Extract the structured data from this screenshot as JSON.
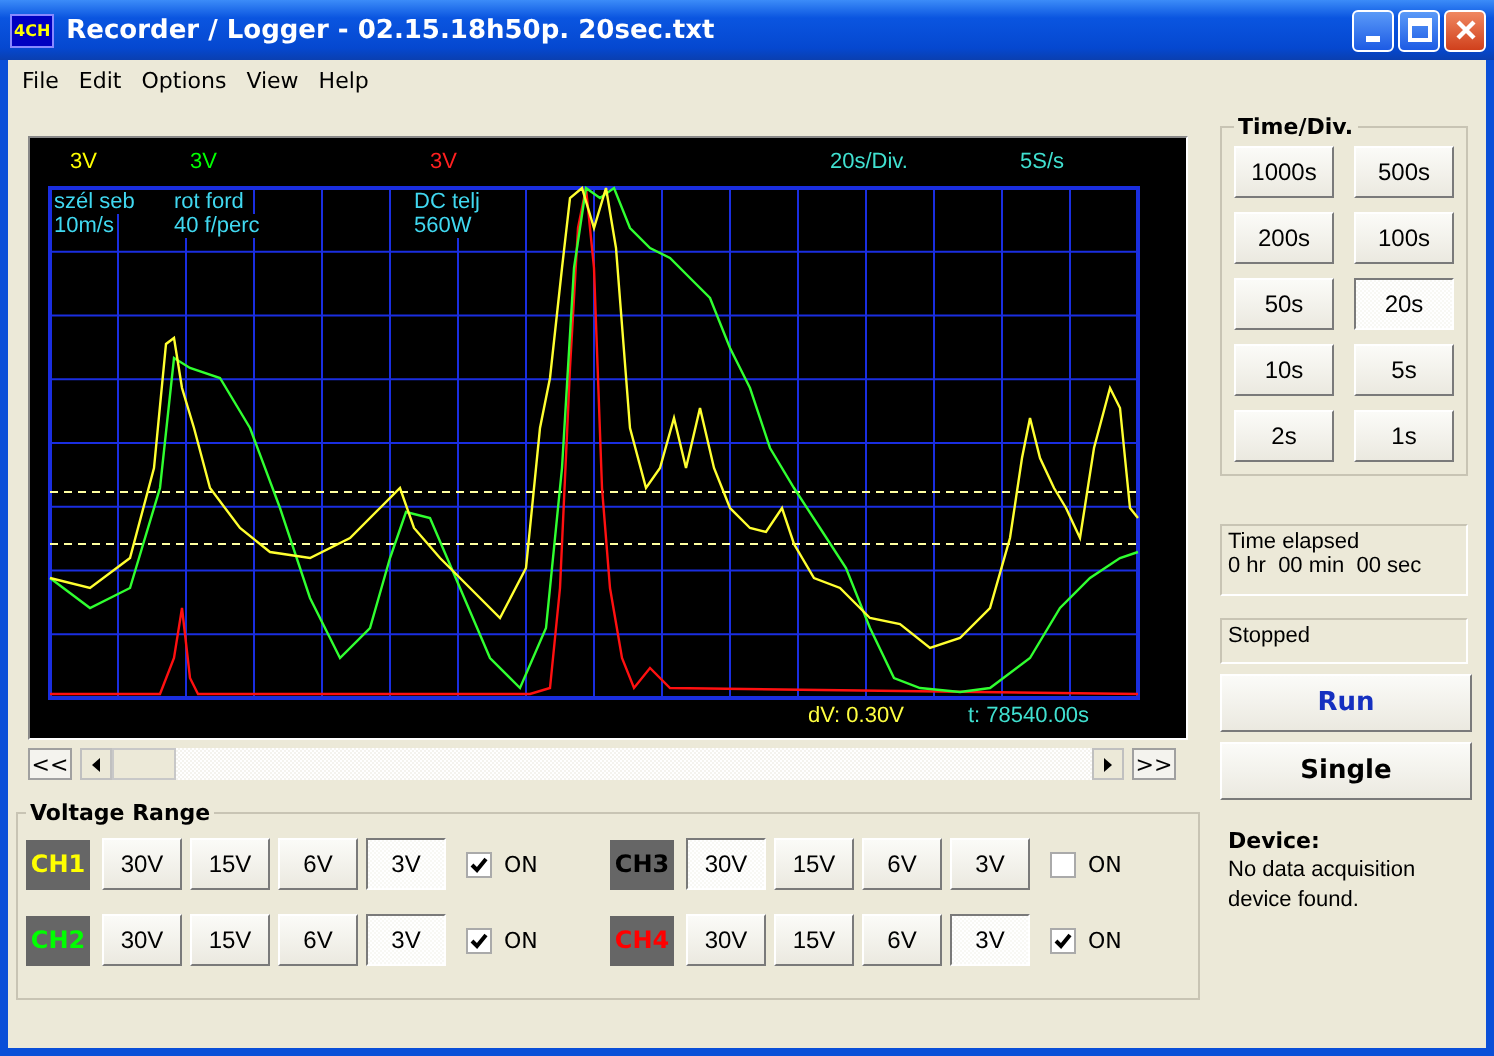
{
  "window": {
    "title": "Recorder / Logger - 02.15.18h50p. 20sec.txt",
    "app_badge": "4CH"
  },
  "menu": [
    "File",
    "Edit",
    "Options",
    "View",
    "Help"
  ],
  "scope": {
    "header_labels": [
      {
        "text": "3V",
        "color": "#ffff00"
      },
      {
        "text": "3V",
        "color": "#00ff00"
      },
      {
        "text": "3V",
        "color": "#ff2020"
      }
    ],
    "time_div": "20s/Div.",
    "sample_rate": "5S/s",
    "channel_names": [
      {
        "name": "szél seb",
        "value": "10m/s"
      },
      {
        "name": "rot ford",
        "value": "40 f/perc"
      },
      {
        "name": "DC telj",
        "value": "560W"
      }
    ],
    "dv_reading": "dV: 0.30V",
    "t_reading": "t: 78540.00s"
  },
  "scrollbar": {
    "first": "<<",
    "last": ">>"
  },
  "time_div": {
    "title": "Time/Div.",
    "buttons": [
      {
        "label": "1000s",
        "selected": false
      },
      {
        "label": "500s",
        "selected": false
      },
      {
        "label": "200s",
        "selected": false
      },
      {
        "label": "100s",
        "selected": false
      },
      {
        "label": "50s",
        "selected": false
      },
      {
        "label": "20s",
        "selected": true
      },
      {
        "label": "10s",
        "selected": false
      },
      {
        "label": "5s",
        "selected": false
      },
      {
        "label": "2s",
        "selected": false
      },
      {
        "label": "1s",
        "selected": false
      }
    ]
  },
  "elapsed": {
    "label": "Time elapsed",
    "value": "0 hr  00 min  00 sec"
  },
  "status": "Stopped",
  "run_button": "Run",
  "single_button": "Single",
  "device": {
    "label": "Device:",
    "message": "No data acquisition device found."
  },
  "voltage_range": {
    "title": "Voltage Range",
    "channels": [
      {
        "name": "CH1",
        "color": "#ffff00",
        "ranges": [
          {
            "label": "30V",
            "selected": false
          },
          {
            "label": "15V",
            "selected": false
          },
          {
            "label": "6V",
            "selected": false
          },
          {
            "label": "3V",
            "selected": true
          }
        ],
        "on_label": "ON",
        "checked": true
      },
      {
        "name": "CH3",
        "color": "#000000",
        "ranges": [
          {
            "label": "30V",
            "selected": true
          },
          {
            "label": "15V",
            "selected": false
          },
          {
            "label": "6V",
            "selected": false
          },
          {
            "label": "3V",
            "selected": false
          }
        ],
        "on_label": "ON",
        "checked": false
      },
      {
        "name": "CH2",
        "color": "#00ff00",
        "ranges": [
          {
            "label": "30V",
            "selected": false
          },
          {
            "label": "15V",
            "selected": false
          },
          {
            "label": "6V",
            "selected": false
          },
          {
            "label": "3V",
            "selected": true
          }
        ],
        "on_label": "ON",
        "checked": true
      },
      {
        "name": "CH4",
        "color": "#ff0000",
        "ranges": [
          {
            "label": "30V",
            "selected": false
          },
          {
            "label": "15V",
            "selected": false
          },
          {
            "label": "6V",
            "selected": false
          },
          {
            "label": "3V",
            "selected": true
          }
        ],
        "on_label": "ON",
        "checked": true
      }
    ]
  }
}
